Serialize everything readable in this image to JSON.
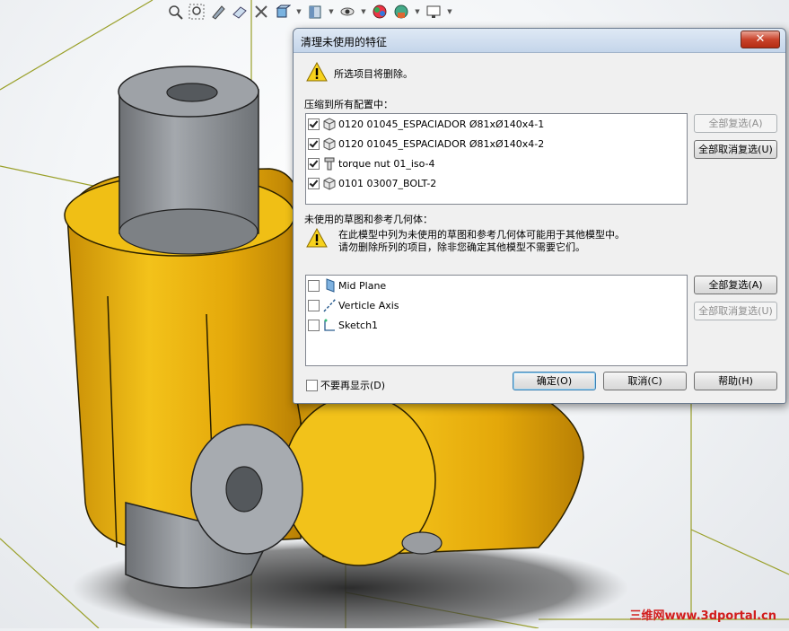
{
  "dialog": {
    "title": "清理未使用的特征",
    "close_label": "✕",
    "delete_warning": "所选项目将删除。",
    "suppress_section_label": "压缩到所有配置中：",
    "suppress_items": [
      {
        "label": "0120 01045_ESPACIADOR Ø81xØ140x4-1",
        "checked": true,
        "icon": "part-icon"
      },
      {
        "label": "0120 01045_ESPACIADOR Ø81xØ140x4-2",
        "checked": true,
        "icon": "part-icon"
      },
      {
        "label": "torque nut 01_iso-4",
        "checked": true,
        "icon": "bolt-icon"
      },
      {
        "label": "0101 03007_BOLT-2",
        "checked": true,
        "icon": "part-icon"
      }
    ],
    "select_all_1": "全部复选(A)",
    "deselect_all_1": "全部取消复选(U)",
    "unused_section_label": "未使用的草图和参考几何体：",
    "unused_warning_line1": "在此模型中列为未使用的草图和参考几何体可能用于其他模型中。",
    "unused_warning_line2": "请勿删除所列的项目，除非您确定其他模型不需要它们。",
    "unused_items": [
      {
        "label": "Mid Plane",
        "checked": false,
        "icon": "plane-icon"
      },
      {
        "label": "Verticle Axis",
        "checked": false,
        "icon": "axis-icon"
      },
      {
        "label": "Sketch1",
        "checked": false,
        "icon": "sketch-icon"
      }
    ],
    "select_all_2": "全部复选(A)",
    "deselect_all_2": "全部取消复选(U)",
    "dont_show_again": "不要再显示(D)",
    "ok_label": "确定(O)",
    "cancel_label": "取消(C)",
    "help_label": "帮助(H)"
  },
  "watermark": "三维网www.3dportal.cn",
  "colors": {
    "model_yellow": "#e8b10c",
    "model_gray": "#8c8f93",
    "bounding_box": "#9aa02a",
    "watermark": "#d21d1d"
  }
}
